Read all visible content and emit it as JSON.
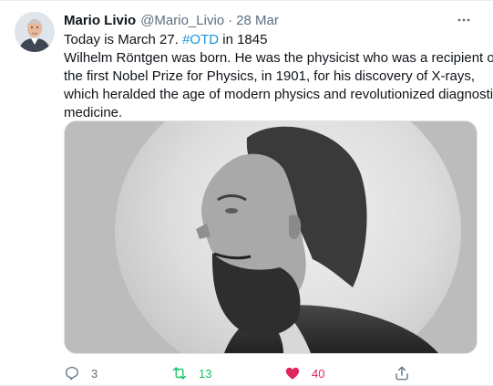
{
  "tweet": {
    "author_name": "Mario Livio",
    "author_handle": "@Mario_Livio",
    "separator": "·",
    "date": "28 Mar",
    "text_line1_prefix": "Today is March 27. ",
    "hashtag": "#OTD",
    "text_line1_suffix": " in 1845",
    "text_lines": [
      "Wilhelm Röntgen was born. He was the physicist who was a recipient of",
      "the first Nobel Prize for Physics, in 1901, for his discovery of X-rays,",
      "which heralded the age of modern physics and revolutionized diagnostic",
      "medicine."
    ],
    "counts": {
      "replies": "3",
      "retweets": "13",
      "likes": "40"
    },
    "icons": {
      "reply": "reply-icon",
      "retweet": "retweet-icon",
      "like": "heart-icon",
      "share": "share-icon",
      "more": "more-icon"
    },
    "colors": {
      "hashtag": "#1b95e0",
      "retweet": "#17bf63",
      "like": "#e0245e",
      "secondary_text": "#5b7083"
    }
  }
}
